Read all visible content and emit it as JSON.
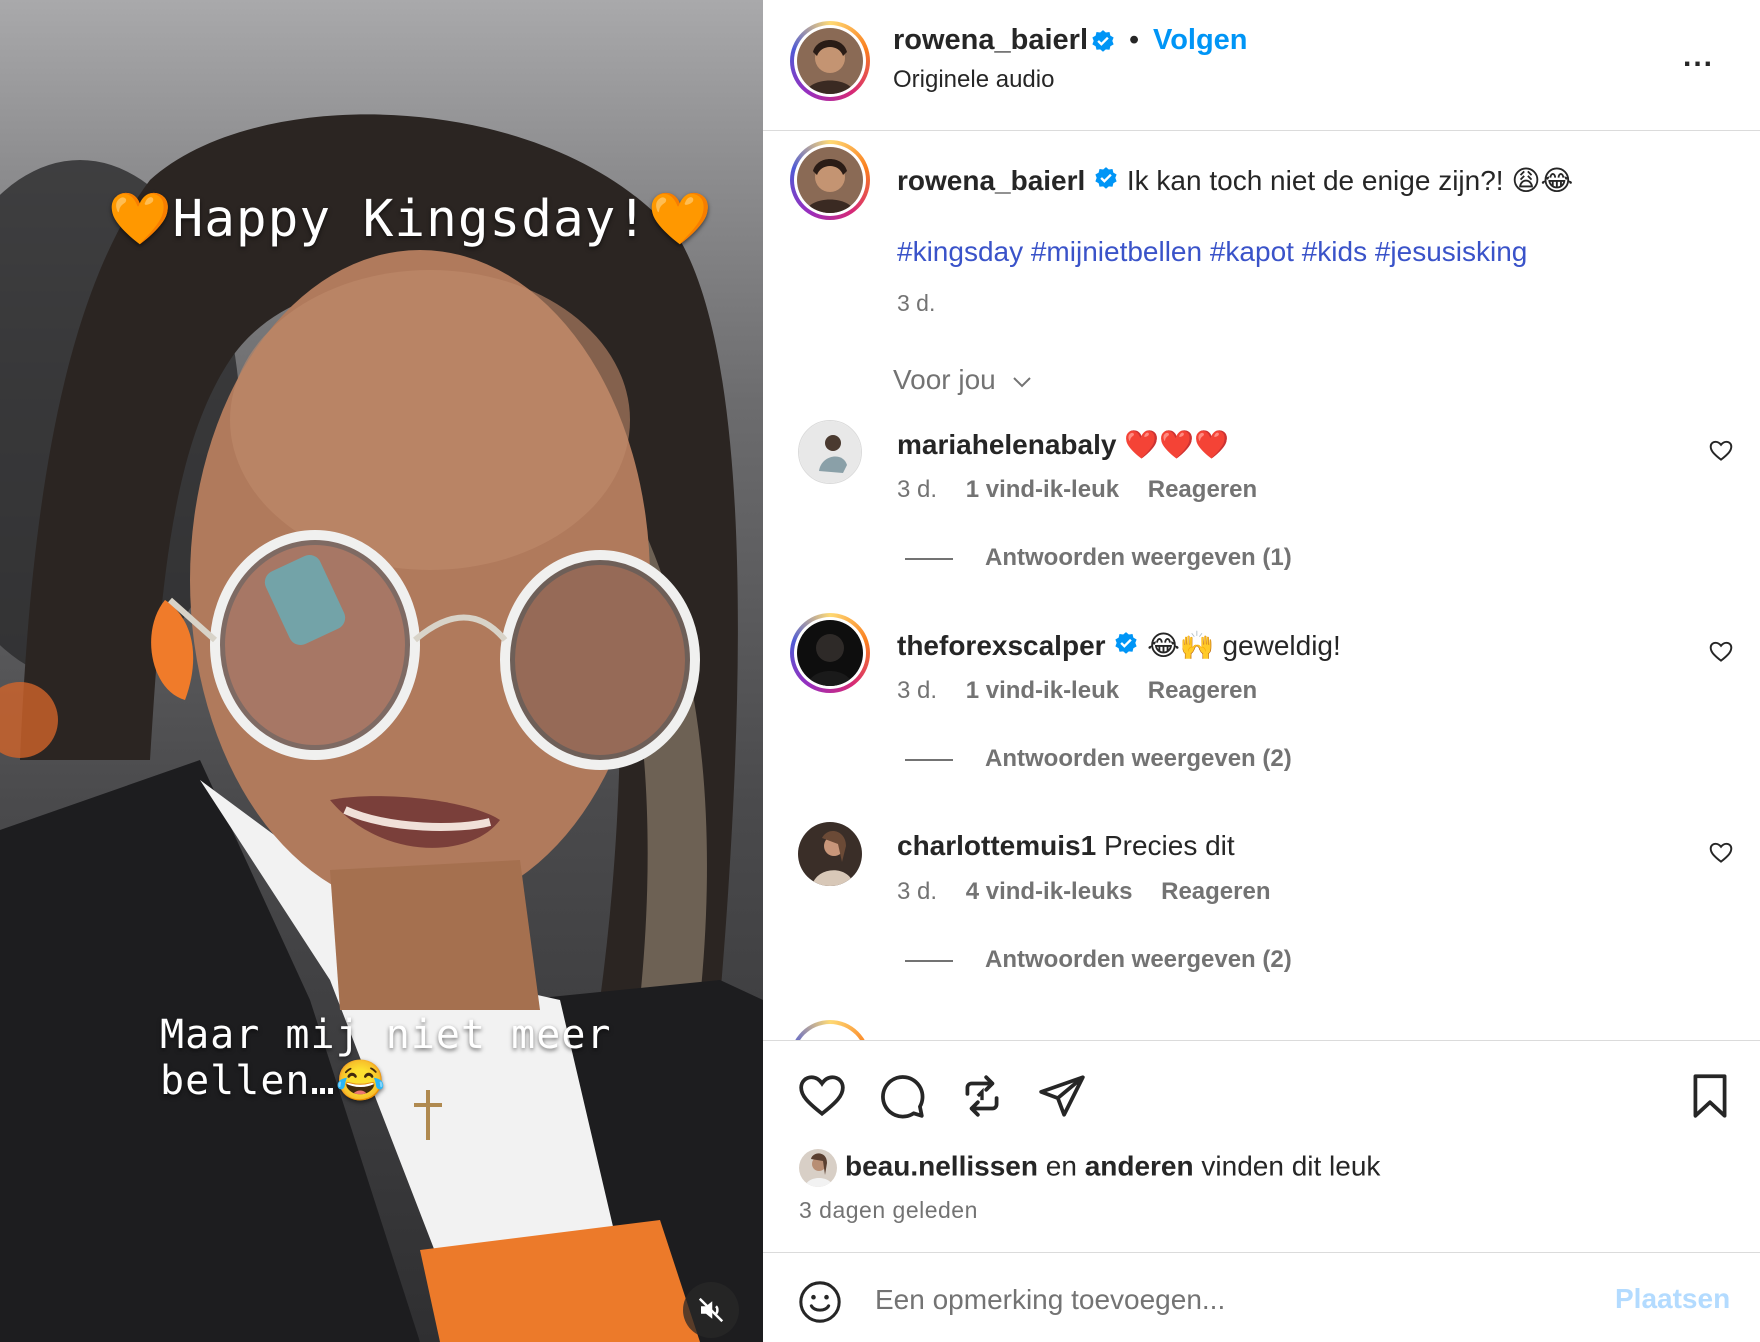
{
  "video": {
    "caption_top": "🧡Happy Kingsday!🧡",
    "caption_bottom": "Maar mij niet meer bellen…😂",
    "mute_icon": "speaker-muted-icon"
  },
  "header": {
    "username": "rowena_baierl",
    "dot": "•",
    "follow_label": "Volgen",
    "audio_label": "Originele audio",
    "more_label": "..."
  },
  "post_caption": {
    "username": "rowena_baierl",
    "text": "Ik kan toch niet de enige zijn?! 😩😂",
    "hashtags": "#kingsday #mijnietbellen #kapot #kids #jesusisking",
    "time": "3 d."
  },
  "sort_label": "Voor jou",
  "comments": [
    {
      "username": "mariahelenabaly",
      "text": "❤️❤️❤️",
      "time": "3 d.",
      "likes": "1 vind-ik-leuk",
      "reply_label": "Reageren",
      "view_replies": "Antwoorden weergeven (1)",
      "verified": false
    },
    {
      "username": "theforexscalper",
      "text": "😂🙌 geweldig!",
      "time": "3 d.",
      "likes": "1 vind-ik-leuk",
      "reply_label": "Reageren",
      "view_replies": "Antwoorden weergeven (2)",
      "verified": true
    },
    {
      "username": "charlottemuis1",
      "text": "Precies dit",
      "time": "3 d.",
      "likes": "4 vind-ik-leuks",
      "reply_label": "Reageren",
      "view_replies": "Antwoorden weergeven (2)",
      "verified": false
    }
  ],
  "likes_summary": {
    "user": "beau.nellissen",
    "and": "en",
    "others": "anderen",
    "suffix": "vinden dit leuk"
  },
  "posted_time": "3 dagen geleden",
  "add_comment": {
    "placeholder": "Een opmerking toevoegen...",
    "post_label": "Plaatsen"
  },
  "colors": {
    "link_blue": "#0095f6",
    "hashtag_blue": "#3a53c9",
    "muted_gray": "#737373",
    "verified_blue": "#0095f6",
    "like_red": "#ed4956"
  }
}
